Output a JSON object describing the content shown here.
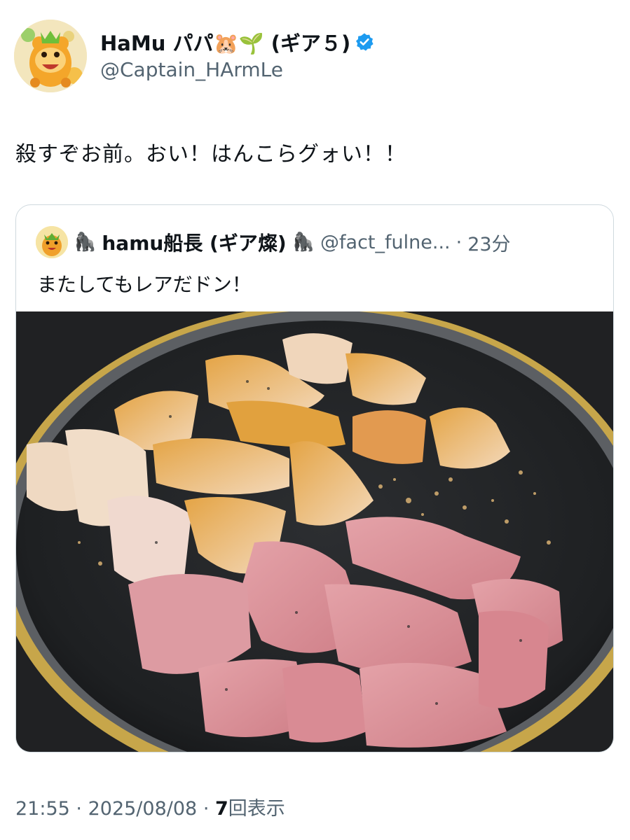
{
  "tweet": {
    "display_name": "HaMu パパ🐹🌱 (ギア５)",
    "handle": "@Captain_HArmLe",
    "text": "殺すぞお前。おい！はんこらグォい！！",
    "verified_color": "#1d9bf0",
    "avatar_icon": "cartoon-hamster-avatar-icon"
  },
  "quoted": {
    "gorilla_left": "🦍",
    "display_name": "hamu船長 (ギア燦)",
    "gorilla_right": "🦍",
    "handle": "@fact_fulne...",
    "separator": "·",
    "time": "23分",
    "text": "またしてもレアだドン！",
    "image_icon": "chicken-in-frying-pan-photo"
  },
  "meta": {
    "time": "21:55",
    "sep1": "·",
    "date": "2025/08/08",
    "sep2": "·",
    "views_count": "7",
    "views_label": "回表示"
  }
}
